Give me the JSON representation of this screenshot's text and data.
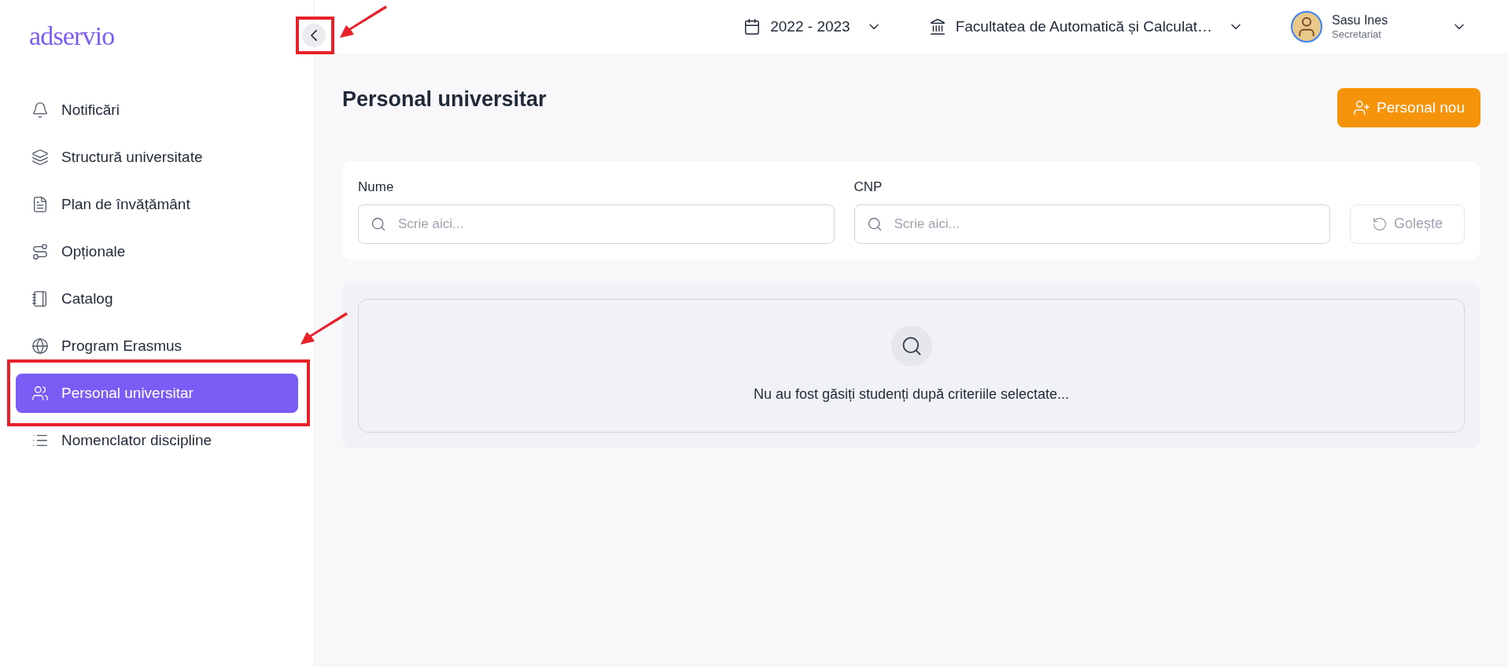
{
  "logo": "adservio",
  "sidebar": {
    "items": [
      {
        "kind": "bell",
        "label": "Notificări",
        "selected": false
      },
      {
        "kind": "layers",
        "label": "Structură universitate",
        "selected": false
      },
      {
        "kind": "document",
        "label": "Plan de învățământ",
        "selected": false
      },
      {
        "kind": "route",
        "label": "Opționale",
        "selected": false
      },
      {
        "kind": "notebook",
        "label": "Catalog",
        "selected": false
      },
      {
        "kind": "globe",
        "label": "Program Erasmus",
        "selected": false
      },
      {
        "kind": "users",
        "label": "Personal universitar",
        "selected": true
      },
      {
        "kind": "list",
        "label": "Nomenclator discipline",
        "selected": false
      }
    ]
  },
  "topbar": {
    "year": "2022 - 2023",
    "faculty": "Facultatea de Automatică și Calculat…",
    "user": {
      "name": "Sasu Ines",
      "role": "Secretariat"
    }
  },
  "page": {
    "title": "Personal universitar",
    "new_button": "Personal nou",
    "filters": [
      {
        "label": "Nume",
        "placeholder": "Scrie aici..."
      },
      {
        "label": "CNP",
        "placeholder": "Scrie aici..."
      }
    ],
    "clear_button": {
      "label": "Golește",
      "disabled": true
    },
    "empty_message": "Nu au fost găsiți studenți după criteriile selectate..."
  }
}
